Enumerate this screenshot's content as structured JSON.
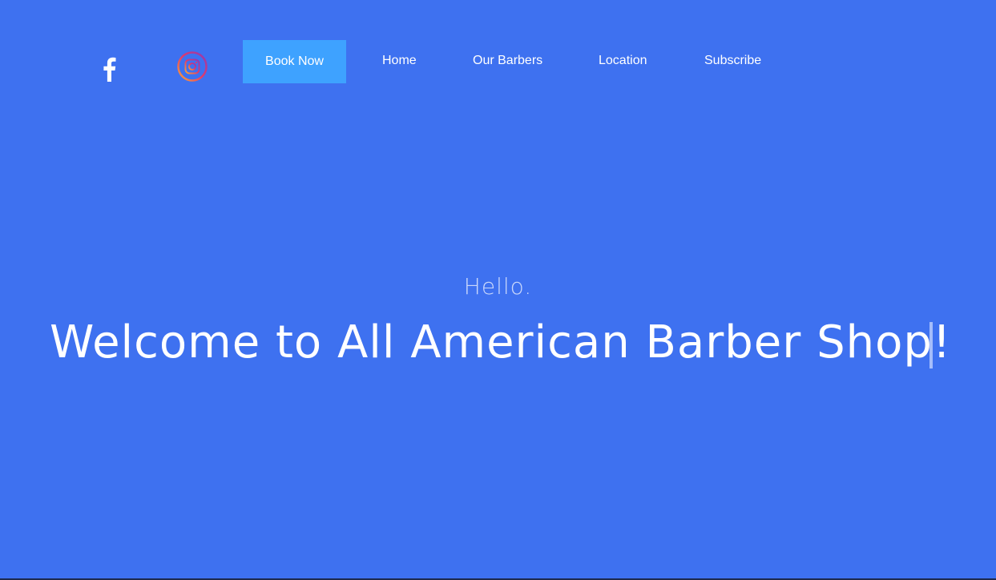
{
  "header": {
    "social": {
      "facebook_icon": "facebook-icon",
      "instagram_icon": "instagram-icon"
    },
    "book_now_label": "Book Now",
    "nav": {
      "home": "Home",
      "our_barbers": "Our Barbers",
      "location": "Location",
      "subscribe": "Subscribe"
    }
  },
  "hero": {
    "greeting": "Hello.",
    "headline": "Welcome to All American Barber Shop!"
  },
  "colors": {
    "background": "#3e71f0",
    "button": "#3ea2ff",
    "text": "#ffffff"
  }
}
